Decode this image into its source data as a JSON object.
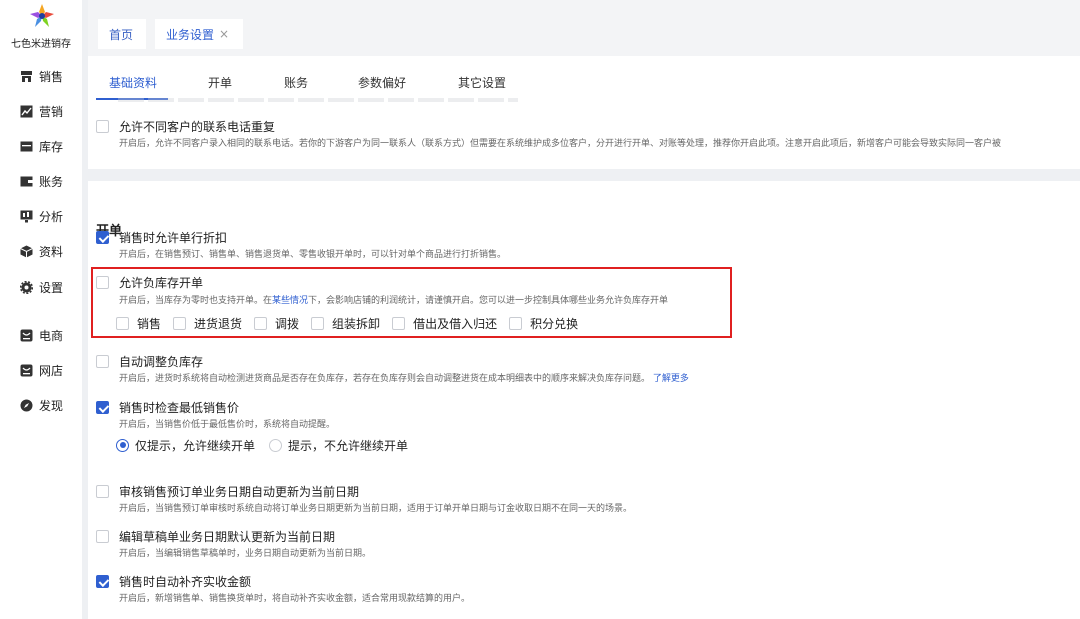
{
  "app": {
    "name": "七色米进销存"
  },
  "sidebar": {
    "items": [
      {
        "label": "销售",
        "icon": "shop-icon"
      },
      {
        "label": "营销",
        "icon": "marketing-chart-icon"
      },
      {
        "label": "库存",
        "icon": "inventory-icon"
      },
      {
        "label": "账务",
        "icon": "ledger-icon"
      },
      {
        "label": "分析",
        "icon": "analysis-icon"
      },
      {
        "label": "资料",
        "icon": "data-cube-icon"
      },
      {
        "label": "设置",
        "icon": "gear-icon"
      },
      {
        "label": "电商",
        "icon": "ecommerce-icon"
      },
      {
        "label": "网店",
        "icon": "web-store-icon"
      },
      {
        "label": "发现",
        "icon": "compass-icon"
      }
    ]
  },
  "tabs": {
    "home": "首页",
    "active": "业务设置",
    "close": "×"
  },
  "subtabs": [
    "基础资料",
    "开单",
    "账务",
    "参数偏好",
    "其它设置"
  ],
  "top_option": {
    "title": "允许不同客户的联系电话重复",
    "desc": "开启后，允许不同客户录入相同的联系电话。若你的下游客户为同一联系人（联系方式）但需要在系统维护成多位客户，分开进行开单、对账等处理，推荐你开启此项。注意开启此项后，新增客户可能会导致实际同一客户被"
  },
  "section": {
    "title": "开单"
  },
  "options": {
    "discount": {
      "title": "销售时允许单行折扣",
      "desc": "开启后，在销售预订、销售单、销售退货单、零售收银开单时，可以针对单个商品进行打折销售。",
      "checked": true
    },
    "negative_stock": {
      "title": "允许负库存开单",
      "desc_before": "开启后，当库存为零时也支持开单。在",
      "desc_link": "某些情况",
      "desc_after": "下，会影响店铺的利润统计，请谨慎开启。您可以进一步控制具体哪些业务允许负库存开单",
      "checked": false,
      "sub_items": [
        "销售",
        "进货退货",
        "调拨",
        "组装拆卸",
        "借出及借入归还",
        "积分兑换"
      ]
    },
    "auto_adjust": {
      "title": "自动调整负库存",
      "desc": "开启后，进货时系统将自动检测进货商品是否存在负库存，若存在负库存则会自动调整进货在成本明细表中的顺序来解决负库存问题。",
      "link": "了解更多",
      "checked": false
    },
    "min_price": {
      "title": "销售时检查最低销售价",
      "desc": "开启后，当销售价低于最低售价时，系统将自动提醒。",
      "checked": true,
      "radio": [
        "仅提示，允许继续开单",
        "提示，不允许继续开单"
      ],
      "radio_selected": 0
    },
    "audit_date": {
      "title": "审核销售预订单业务日期自动更新为当前日期",
      "desc": "开启后，当销售预订单审核时系统自动将订单业务日期更新为当前日期，适用于订单开单日期与订金收取日期不在同一天的场景。",
      "checked": false
    },
    "draft_date": {
      "title": "编辑草稿单业务日期默认更新为当前日期",
      "desc": "开启后，当编辑销售草稿单时，业务日期自动更新为当前日期。",
      "checked": false
    },
    "auto_fill": {
      "title": "销售时自动补齐实收金额",
      "desc": "开启后，新增销售单、销售换货单时，将自动补齐实收金额，适合常用现款结算的用户。",
      "checked": true
    }
  },
  "colors": {
    "accent": "#2f5fd0",
    "highlight": "#e02020"
  }
}
